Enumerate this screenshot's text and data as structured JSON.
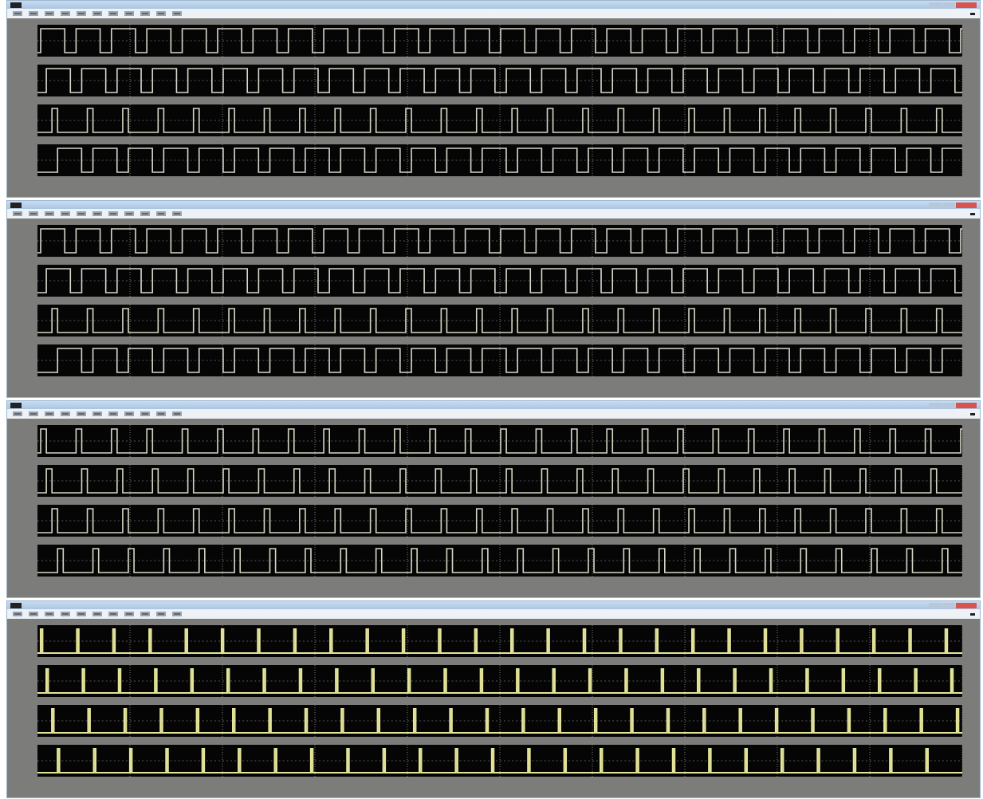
{
  "windows": [
    {
      "plots": [
        {
          "kind": "square"
        },
        {
          "kind": "square"
        },
        {
          "kind": "pulse"
        },
        {
          "kind": "square"
        }
      ]
    },
    {
      "plots": [
        {
          "kind": "square"
        },
        {
          "kind": "square"
        },
        {
          "kind": "pulse"
        },
        {
          "kind": "square"
        }
      ]
    },
    {
      "plots": [
        {
          "kind": "pulse"
        },
        {
          "kind": "pulse"
        },
        {
          "kind": "pulse"
        },
        {
          "kind": "pulse"
        }
      ]
    },
    {
      "plots": [
        {
          "kind": "spike"
        },
        {
          "kind": "spike"
        },
        {
          "kind": "spike"
        },
        {
          "kind": "spike"
        }
      ]
    }
  ]
}
